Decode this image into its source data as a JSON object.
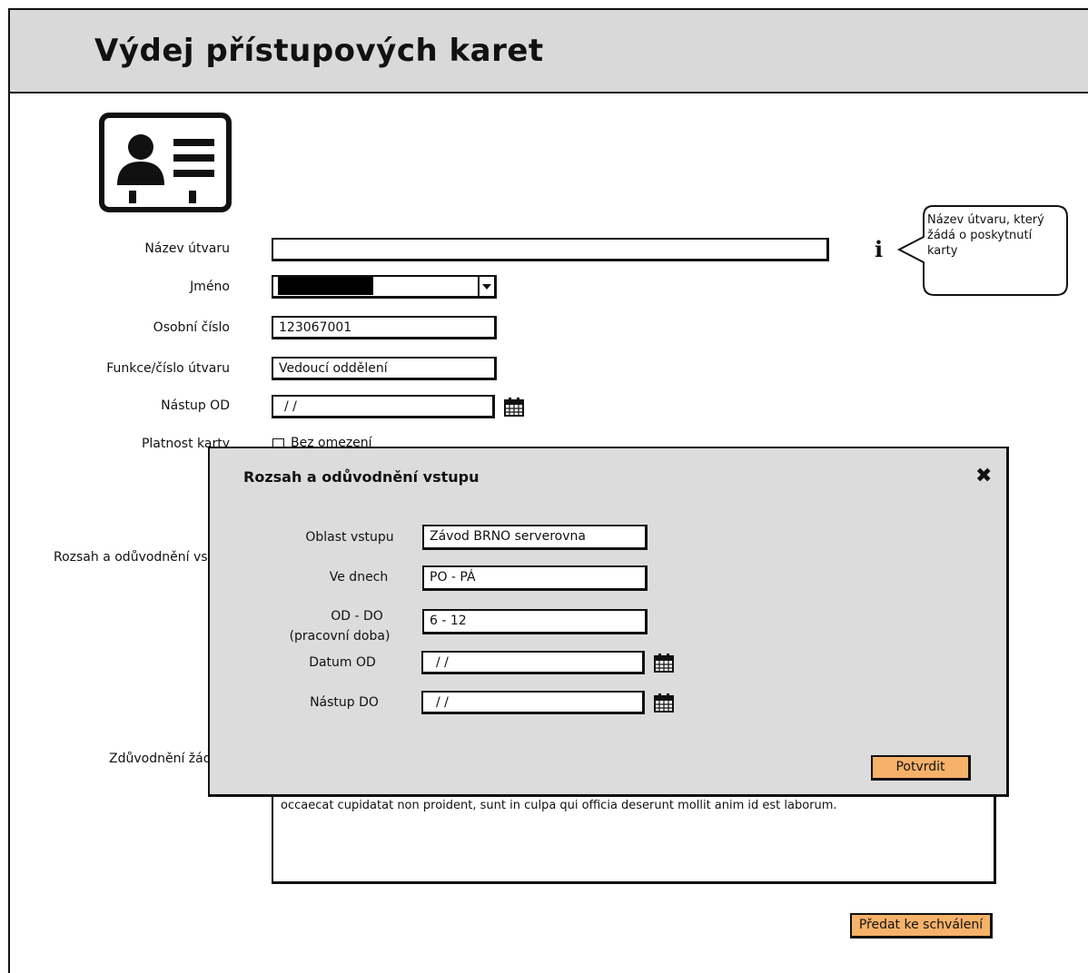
{
  "page": {
    "title": "Výdej přístupových karet"
  },
  "form": {
    "unit_name": {
      "label": "Název útvaru",
      "value": ""
    },
    "name": {
      "label": "Jméno",
      "value": ""
    },
    "personal_number": {
      "label": "Osobní číslo",
      "value": "123067001"
    },
    "function_unit": {
      "label": "Funkce/číslo útvaru",
      "value": "Vedoucí oddělení"
    },
    "start_from": {
      "label": "Nástup OD",
      "value": "/ /"
    },
    "card_validity": {
      "label": "Platnost karty",
      "checkbox_label": "Bez omezení"
    },
    "access_scope": {
      "label": "Rozsah a odůvodnění vstupu"
    },
    "justification": {
      "label": "Zdůvodnění žádosti",
      "text": "occaecat cupidatat non proident, sunt in culpa qui officia deserunt mollit anim id est laborum."
    },
    "submit_label": "Předat ke schválení"
  },
  "tooltip": {
    "text": "Název útvaru, který žádá o poskytnutí karty"
  },
  "modal": {
    "title": "Rozsah a odůvodnění vstupu",
    "area": {
      "label": "Oblast vstupu",
      "value": "Závod BRNO serverovna"
    },
    "days": {
      "label": "Ve dnech",
      "value": "PO - PÁ"
    },
    "hours": {
      "label": "OD - DO",
      "sublabel": "(pracovní doba)",
      "value": "6 - 12"
    },
    "date_from": {
      "label": "Datum OD",
      "value": "/ /"
    },
    "start_to": {
      "label": "Nástup DO",
      "value": "/ /"
    },
    "confirm_label": "Potvrdit"
  },
  "colors": {
    "header_bg": "#d9d9d9",
    "accent_button": "#f7b26a",
    "modal_bg": "#dcdcdc"
  },
  "icons": [
    "id-card-icon",
    "info-icon",
    "dropdown-arrow-icon",
    "calendar-icon",
    "close-icon",
    "checkbox-icon"
  ]
}
